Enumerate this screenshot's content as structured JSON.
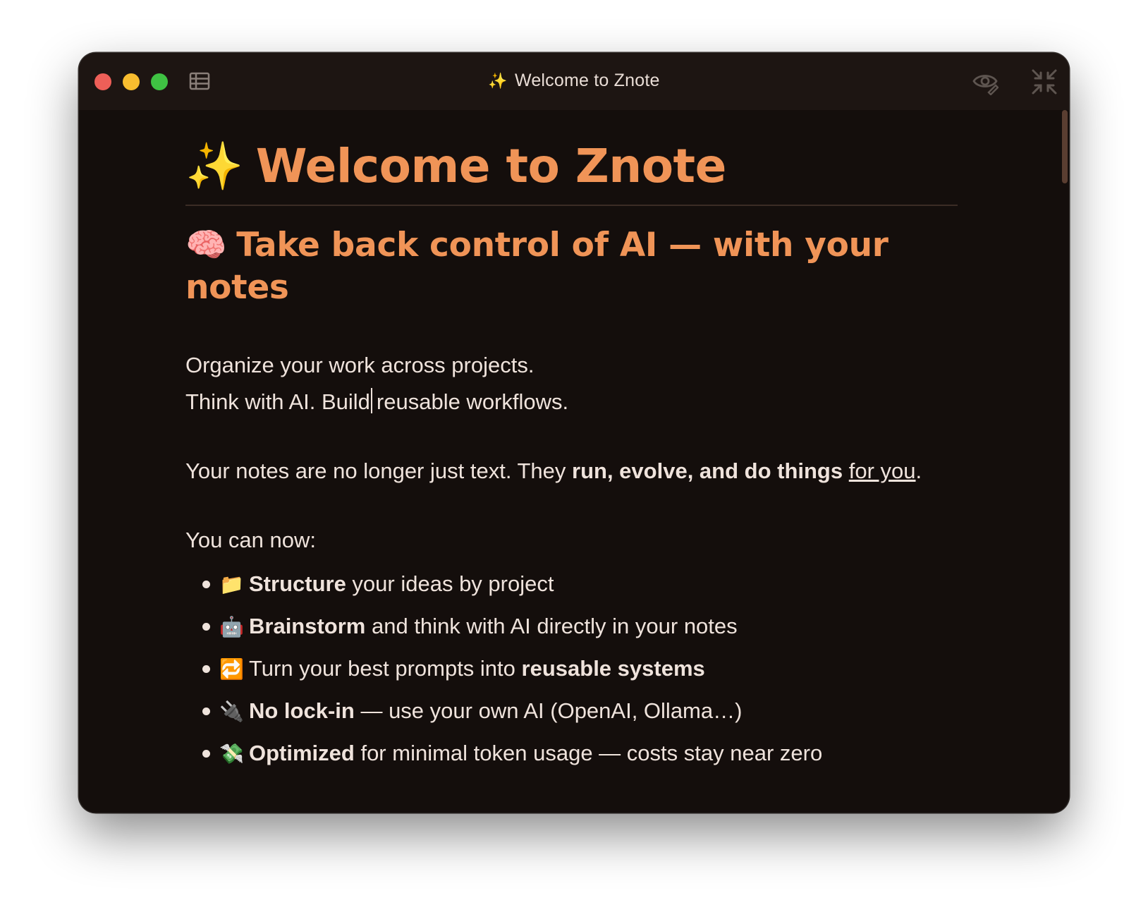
{
  "window": {
    "title": "Welcome to Znote",
    "title_icon": "✨",
    "controls": {
      "close_color": "#ee5f58",
      "minimize_color": "#f8bd2f",
      "maximize_color": "#3fc243"
    },
    "toolbar_icons": [
      "sidebar-toggle-icon",
      "preview-eye-icon",
      "collapse-icon"
    ]
  },
  "document": {
    "h1_emoji": "✨",
    "h1": "Welcome to Znote",
    "h2_emoji": "🧠",
    "h2": "Take back control of AI — with your notes",
    "intro_line1": "Organize your work across projects.",
    "intro_line2_before_caret": "Think with AI. Build",
    "intro_line2_after_caret": "reusable workflows.",
    "notes_line": {
      "plain": "Your notes are no longer just text. They ",
      "bold": "run, evolve, and do things",
      "space": " ",
      "underlined": "for you",
      "end": "."
    },
    "list_intro": "You can now:",
    "features": [
      {
        "emoji": "📁",
        "bold": "Structure",
        "text": " your ideas by project"
      },
      {
        "emoji": "🤖",
        "bold": "Brainstorm",
        "text": " and think with AI directly in your notes"
      },
      {
        "emoji": "🔁",
        "text": "Turn your best prompts into ",
        "bold_end": "reusable systems"
      },
      {
        "emoji": "🔌",
        "bold": "No lock-in",
        "text": " — use your own AI (OpenAI, Ollama…)"
      },
      {
        "emoji": "💸",
        "bold": "Optimized",
        "text": " for minimal token usage — costs stay near zero"
      }
    ]
  },
  "colors": {
    "heading": "#f09457",
    "body_text": "#efe3dc",
    "background": "#140e0c",
    "titlebar": "#1d1512"
  }
}
